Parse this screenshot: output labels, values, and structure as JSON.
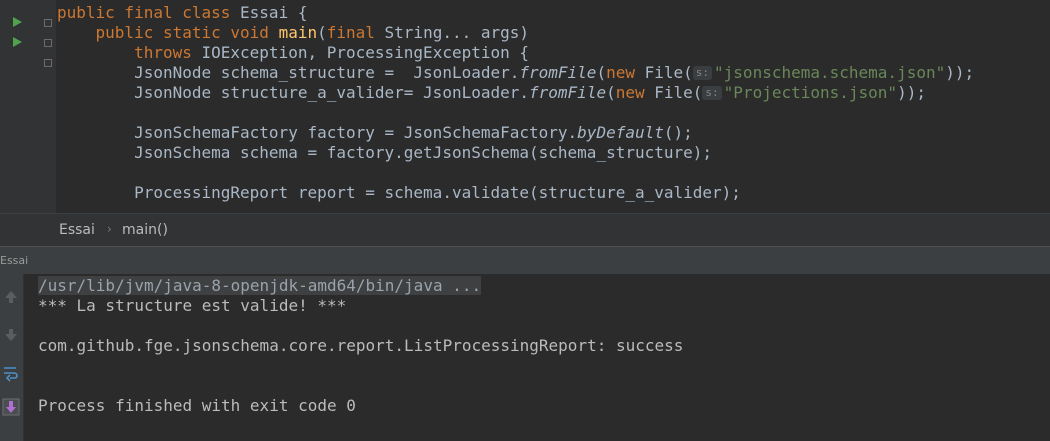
{
  "editor": {
    "line1": {
      "kw": "public final class ",
      "classname": "Essai",
      "rest": " {"
    },
    "line2": {
      "kw": "public static void ",
      "method": "main",
      "open": "(",
      "kw2": "final ",
      "rest": "String... args)"
    },
    "line3": {
      "kw": "throws ",
      "rest": "IOException, ProcessingException {"
    },
    "line4": {
      "a": "JsonNode schema_structure =  JsonLoader.",
      "m": "fromFile",
      "b": "(",
      "kw": "new ",
      "c": "File(",
      "hint": "s:",
      "str": "\"jsonschema.schema.json\"",
      "d": "));"
    },
    "line5": {
      "a": "JsonNode structure_a_valider= JsonLoader.",
      "m": "fromFile",
      "b": "(",
      "kw": "new ",
      "c": "File(",
      "hint": "s:",
      "str": "\"Projections.json\"",
      "d": "));"
    },
    "line7": {
      "a": "JsonSchemaFactory factory = JsonSchemaFactory.",
      "m": "byDefault",
      "b": "();"
    },
    "line8": {
      "a": "JsonSchema schema = factory.getJsonSchema(schema_structure);"
    },
    "line10": {
      "a": "ProcessingReport report = schema.validate(structure_a_valider);"
    }
  },
  "breadcrumbs": {
    "class": "Essai",
    "sep": "›",
    "method": "main()"
  },
  "run_panel": {
    "title": "Essai"
  },
  "console": {
    "cmd": "/usr/lib/jvm/java-8-openjdk-amd64/bin/java ...",
    "out1": "*** La structure est valide! ***",
    "out2": "com.github.fge.jsonschema.core.report.ListProcessingReport: success",
    "out3": "Process finished with exit code 0"
  },
  "colors": {
    "keyword": "#cc7832",
    "method": "#ffc66d",
    "string": "#6a8759",
    "text": "#a9b7c6",
    "background": "#2b2b2b"
  },
  "icons": [
    "run-arrow-icon",
    "fold-icon",
    "scroll-up-icon",
    "scroll-down-icon",
    "soft-wrap-icon",
    "scroll-to-end-icon"
  ]
}
